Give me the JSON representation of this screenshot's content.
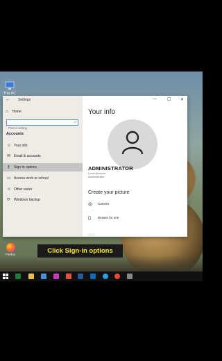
{
  "desktop": {
    "icons": [
      {
        "label": "This PC"
      },
      {
        "label": "Firefox"
      }
    ]
  },
  "settings": {
    "title": "Settings",
    "home": "Home",
    "search_placeholder": "Find a setting",
    "section": "Accounts",
    "nav": [
      {
        "label": "Your info",
        "icon": "person-icon"
      },
      {
        "label": "Email & accounts",
        "icon": "mail-icon"
      },
      {
        "label": "Sign-in options",
        "icon": "key-icon",
        "active": true
      },
      {
        "label": "Access work or school",
        "icon": "briefcase-icon"
      },
      {
        "label": "Other users",
        "icon": "people-icon"
      },
      {
        "label": "Windows backup",
        "icon": "sync-icon"
      }
    ],
    "page_title": "Your info",
    "user_name": "ADMINISTRATOR",
    "user_type1": "Local Account",
    "user_type2": "Administrator",
    "create_picture": "Create your picture",
    "picture_options": [
      {
        "label": "Camera",
        "icon": "camera-icon"
      },
      {
        "label": "Browse for one",
        "icon": "browse-icon"
      }
    ],
    "clipped_heading": "Acc"
  },
  "caption": "Click Sign-in options",
  "colors": {
    "caption_text": "#ffe83c",
    "caption_bg": "#1a1a1a",
    "search_border": "#5a8fc7"
  }
}
